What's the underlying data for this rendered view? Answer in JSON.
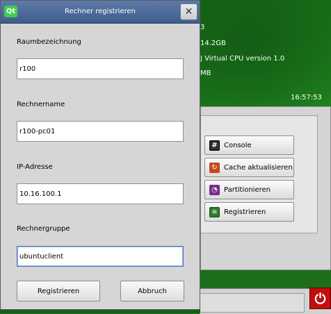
{
  "desktop": {
    "lines": [
      "3",
      "14.2GB",
      "J Virtual CPU version 1.0",
      "MB"
    ],
    "clock": "16:57:53"
  },
  "dialog": {
    "title": "Rechner registrieren",
    "logo": "Qt",
    "close_glyph": "✕",
    "fields": [
      {
        "label": "Raumbezeichnung",
        "value": "r100"
      },
      {
        "label": "Rechnername",
        "value": "r100-pc01"
      },
      {
        "label": "IP-Adresse",
        "value": "10.16.100.1"
      },
      {
        "label": "Rechnergruppe",
        "value": "ubuntuclient"
      }
    ],
    "register_label": "Registrieren",
    "cancel_label": "Abbruch"
  },
  "actions": [
    {
      "label": "Console",
      "icon": "console-icon",
      "glyph": "#"
    },
    {
      "label": "Cache aktualisieren",
      "icon": "refresh-icon",
      "glyph": "↻"
    },
    {
      "label": "Partitionieren",
      "icon": "partition-icon",
      "glyph": "◔"
    },
    {
      "label": "Registrieren",
      "icon": "register-icon",
      "glyph": "≡"
    }
  ],
  "power_glyph": "⏻",
  "colors": {
    "titlebar": "#4a6897",
    "desktop": "#1e7a1e",
    "power": "#c40d0d"
  }
}
